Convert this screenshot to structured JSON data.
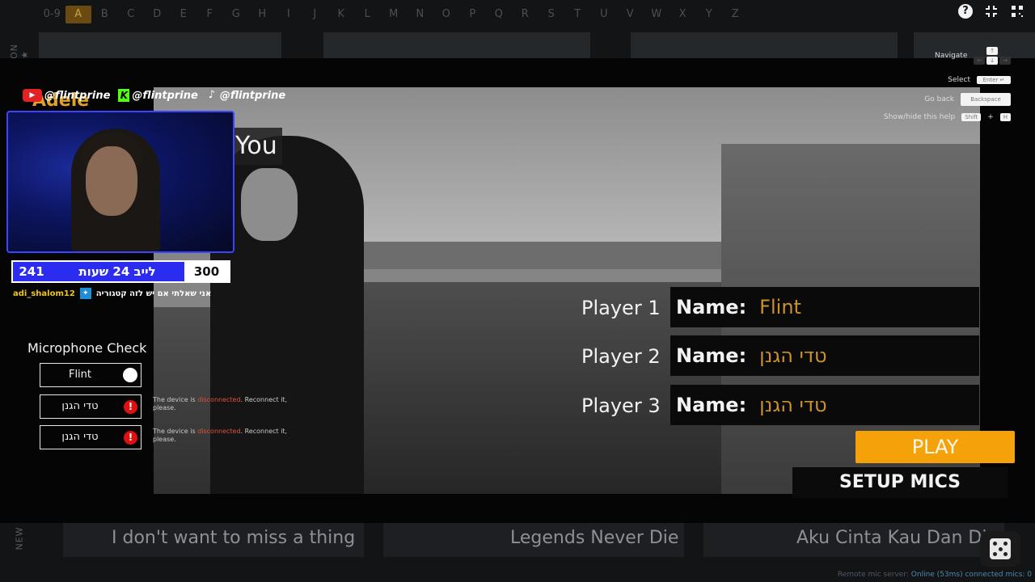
{
  "alphabet": {
    "items": [
      "0-9",
      "A",
      "B",
      "C",
      "D",
      "E",
      "F",
      "G",
      "H",
      "I",
      "J",
      "K",
      "L",
      "M",
      "N",
      "O",
      "P",
      "Q",
      "R",
      "S",
      "T",
      "U",
      "V",
      "W",
      "X",
      "Y",
      "Z"
    ],
    "active": "A"
  },
  "side_labels": {
    "top": "ON ★",
    "bottom": "NEW"
  },
  "video_overlay": {
    "artist": "Adele",
    "title_fragment": "You"
  },
  "help": {
    "navigate": "Navigate",
    "select": "Select",
    "go_back": "Go back",
    "toggle_help": "Show/hide this help",
    "keys": {
      "up": "↑",
      "left": "←",
      "down": "↓",
      "right": "→",
      "enter": "Enter ↵",
      "backspace": "Backspace",
      "shift": "Shift",
      "plus": "+",
      "h": "H"
    }
  },
  "stream": {
    "socials": [
      "@flintprine",
      "@flintprine",
      "@flintprine"
    ],
    "social_icons": [
      "youtube-icon",
      "kick-icon",
      "tiktok-icon"
    ],
    "counter": {
      "left": "241",
      "label": "לייב 24 שעות",
      "right": "300"
    },
    "chat": {
      "user": "adi_shalom12",
      "message": "אני שאלתי אם יש לזה קטגוריה"
    }
  },
  "mic_check": {
    "title": "Microphone Check",
    "mics": [
      {
        "name": "Flint",
        "status": "ok"
      },
      {
        "name": "טדי הגנן",
        "status": "error"
      },
      {
        "name": "טדי הגנן",
        "status": "error"
      }
    ],
    "error_note": {
      "before": "The device is ",
      "highlight": "disconnected",
      "after": ". Reconnect it, please."
    }
  },
  "players": [
    {
      "label": "Player 1",
      "name_label": "Name:",
      "name": "Flint"
    },
    {
      "label": "Player 2",
      "name_label": "Name:",
      "name": "טדי הגנן"
    },
    {
      "label": "Player 3",
      "name_label": "Name:",
      "name": "טדי הגנן"
    }
  ],
  "buttons": {
    "play": "PLAY",
    "setup_mics": "SETUP MICS"
  },
  "bottom_songs": [
    "I don't want to miss a thing",
    "Legends Never Die",
    "Aku Cinta Kau Dan Di"
  ],
  "status": {
    "server_label": "Remote mic server:",
    "server_value": "Online (53ms)",
    "mics_label": "connected mics: 0"
  },
  "colors": {
    "accent": "#f5a20a",
    "name_value": "#c9922a",
    "error": "#e01010",
    "counter_blue": "#2c2cf0"
  }
}
